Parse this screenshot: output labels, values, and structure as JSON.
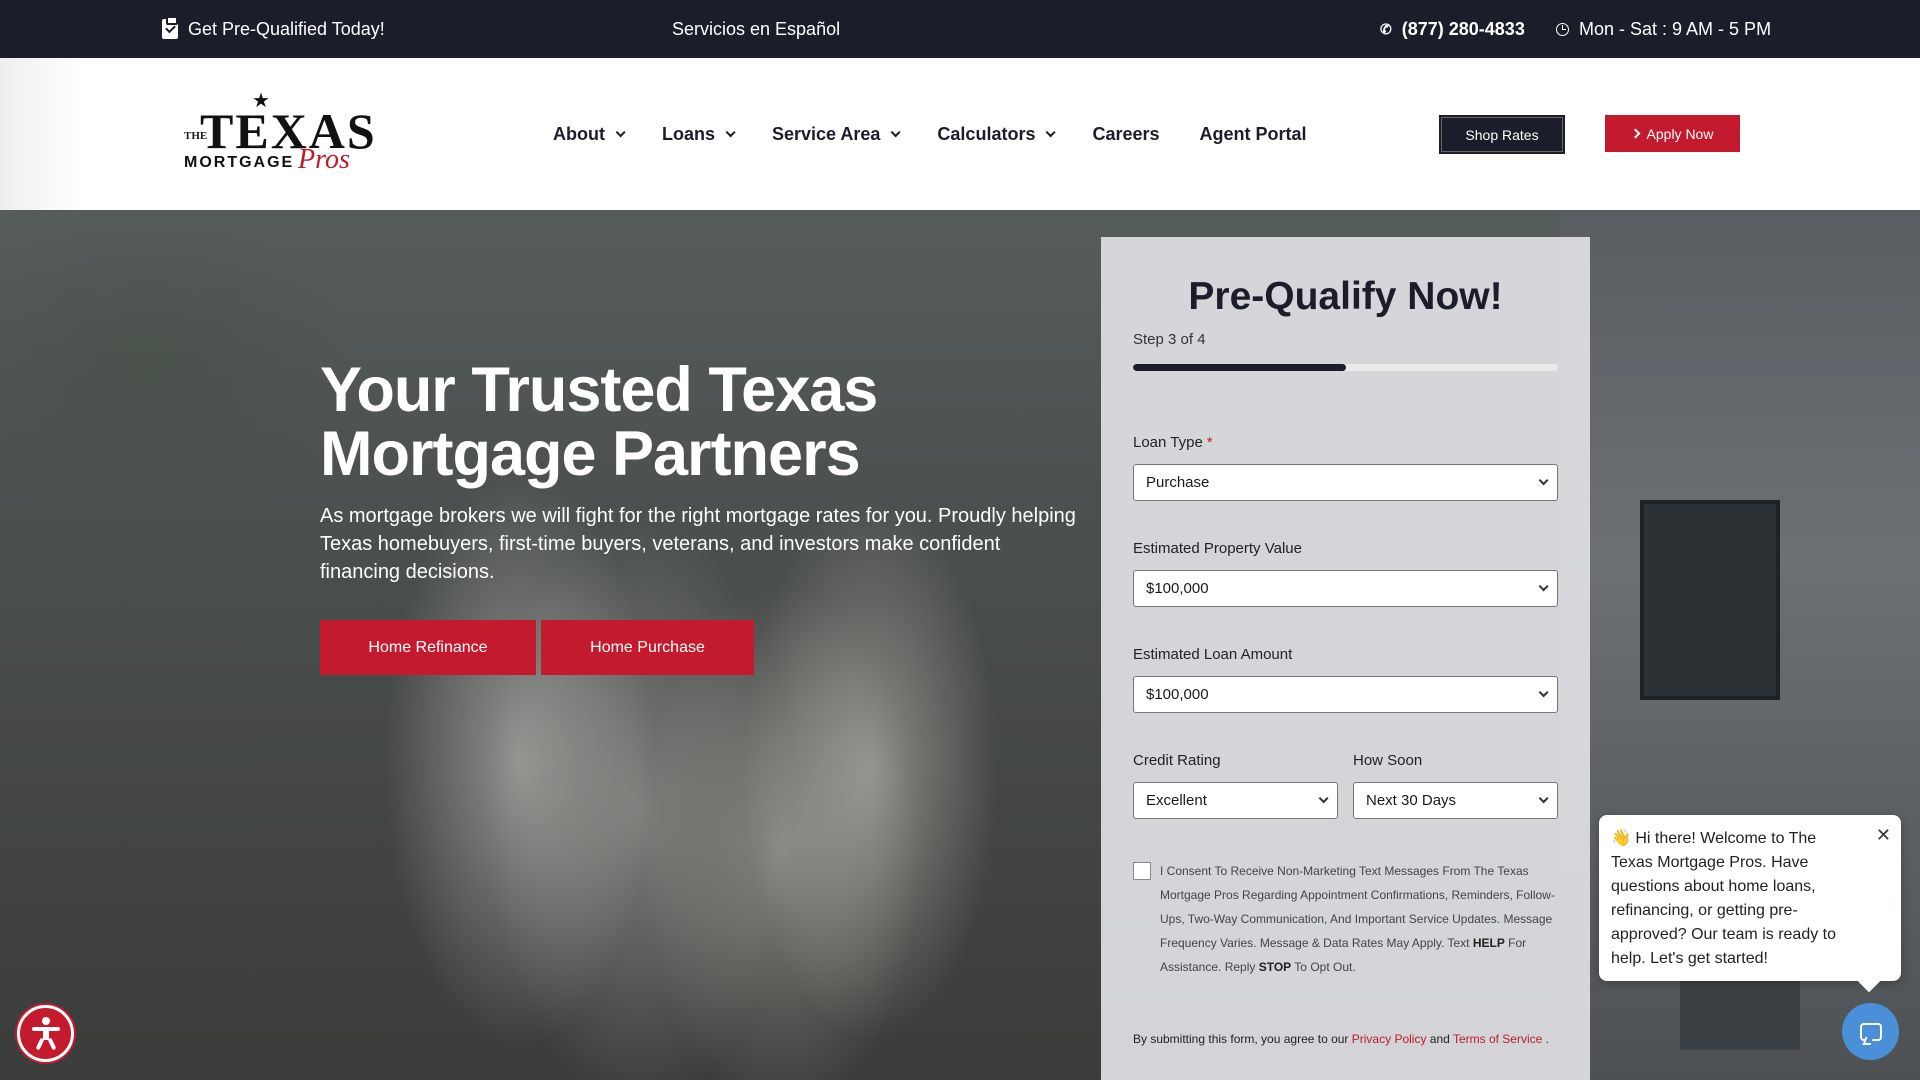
{
  "topbar": {
    "prequal": "Get Pre-Qualified Today!",
    "spanish": "Servicios en Español",
    "phone": "(877) 280-4833",
    "hours": "Mon - Sat : 9 AM - 5 PM"
  },
  "logo": {
    "the": "THE",
    "texas": "TEXAS",
    "mortgage": "MORTGAGE",
    "pros": "Pros"
  },
  "nav": {
    "items": [
      {
        "label": "About",
        "dropdown": true
      },
      {
        "label": "Loans",
        "dropdown": true
      },
      {
        "label": "Service Area",
        "dropdown": true
      },
      {
        "label": "Calculators",
        "dropdown": true
      },
      {
        "label": "Careers",
        "dropdown": false
      },
      {
        "label": "Agent Portal",
        "dropdown": false
      }
    ],
    "shop_rates": "Shop Rates",
    "apply_now": "Apply Now"
  },
  "hero": {
    "title": "Your Trusted Texas Mortgage Partners",
    "subtitle": "As mortgage brokers we will fight for the right mortgage rates for you. Proudly helping Texas homebuyers, first-time buyers, veterans, and investors make confident financing decisions.",
    "btn_refinance": "Home Refinance",
    "btn_purchase": "Home Purchase"
  },
  "form": {
    "title": "Pre-Qualify Now!",
    "step": "Step 3 of 4",
    "progress": 0.5,
    "loan_type_label": "Loan Type",
    "loan_type_required": "*",
    "loan_type_value": "Purchase",
    "property_value_label": "Estimated Property Value",
    "property_value": "$100,000",
    "loan_amount_label": "Estimated Loan Amount",
    "loan_amount": "$100,000",
    "credit_label": "Credit Rating",
    "credit_value": "Excellent",
    "how_soon_label": "How Soon",
    "how_soon_value": "Next 30 Days",
    "consent_text_1": "I Consent To Receive Non-Marketing Text Messages From The Texas Mortgage Pros Regarding Appointment Confirmations, Reminders, Follow-Ups, Two-Way Communication, And Important Service Updates. Message Frequency Varies. Message & Data Rates May Apply. Text ",
    "consent_help": "HELP",
    "consent_text_2": " For Assistance. Reply ",
    "consent_stop": "STOP",
    "consent_text_3": " To Opt Out.",
    "submit_note_1": "By submitting this form, you agree to our ",
    "privacy_link": "Privacy Policy",
    "submit_and": " and ",
    "terms_link": "Terms of Service",
    "submit_end": " ."
  },
  "chat": {
    "message": "👋 Hi there! Welcome to The Texas Mortgage Pros. Have questions about home loans, refinancing, or getting pre-approved? Our team is ready to help. Let's get started!",
    "close": "✕"
  },
  "colors": {
    "brand_dark": "#1c1d2b",
    "brand_red": "#c41a2e",
    "chat_blue": "#4a90d9"
  }
}
